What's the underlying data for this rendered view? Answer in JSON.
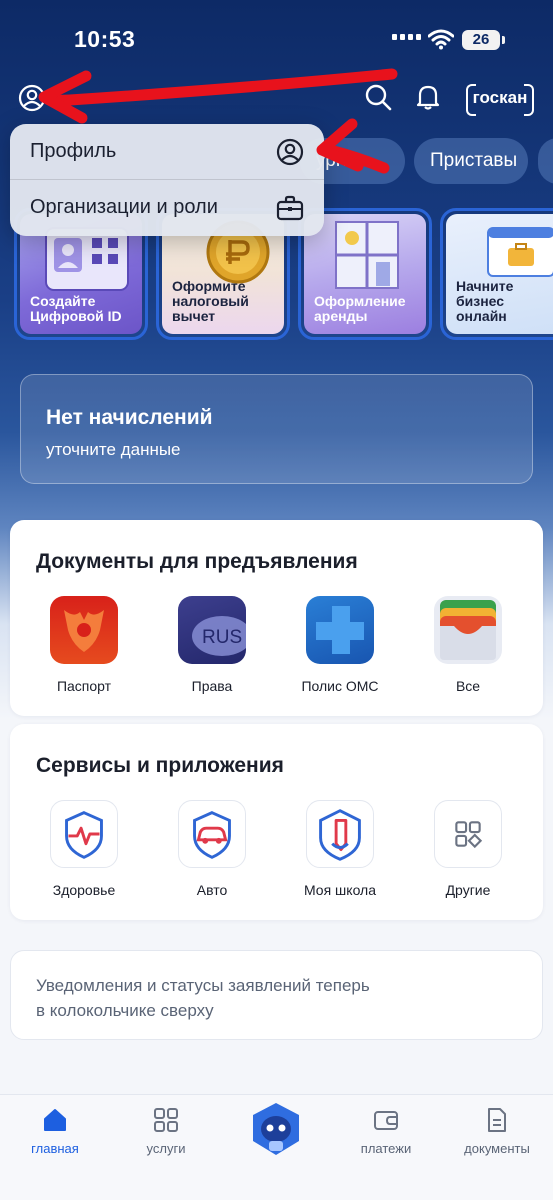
{
  "status_bar": {
    "time": "10:53",
    "battery": "26"
  },
  "header": {
    "goskan_label": "госкан"
  },
  "chips": [
    {
      "label": "ургия"
    },
    {
      "label": "Приставы"
    }
  ],
  "stories": [
    {
      "label_line1": "Создайте",
      "label_line2": "Цифровой ID",
      "label_line3": ""
    },
    {
      "label_line1": "Оформите",
      "label_line2": "налоговый",
      "label_line3": "вычет"
    },
    {
      "label_line1": "Оформление",
      "label_line2": "аренды",
      "label_line3": ""
    },
    {
      "label_line1": "Начните",
      "label_line2": "бизнес",
      "label_line3": "онлайн"
    }
  ],
  "dropdown": {
    "items": [
      {
        "label": "Профиль",
        "icon": "user-circle-icon"
      },
      {
        "label": "Организации и роли",
        "icon": "briefcase-icon"
      }
    ]
  },
  "charges": {
    "title": "Нет начислений",
    "subtitle": "уточните данные"
  },
  "documents": {
    "title": "Документы для предъявления",
    "items": [
      {
        "label": "Паспорт",
        "icon": "passport-icon"
      },
      {
        "label": "Права",
        "icon": "driver-license-icon"
      },
      {
        "label": "Полис ОМС",
        "icon": "medical-policy-icon"
      },
      {
        "label": "Все",
        "icon": "wallet-icon"
      }
    ],
    "license_text": "RUS"
  },
  "services": {
    "title": "Сервисы и приложения",
    "items": [
      {
        "label": "Здоровье",
        "icon": "health-icon"
      },
      {
        "label": "Авто",
        "icon": "car-icon"
      },
      {
        "label": "Моя школа",
        "icon": "school-icon"
      },
      {
        "label": "Другие",
        "icon": "grid-icon"
      }
    ]
  },
  "notice": {
    "text_line1": "Уведомления и статусы заявлений теперь",
    "text_line2": "в колокольчике сверху"
  },
  "bottom_nav": {
    "items": [
      {
        "label": "главная",
        "icon": "home-icon",
        "active": true
      },
      {
        "label": "услуги",
        "icon": "services-grid-icon",
        "active": false
      },
      {
        "label": "",
        "icon": "assistant-robot-icon",
        "active": false
      },
      {
        "label": "платежи",
        "icon": "wallet-payments-icon",
        "active": false
      },
      {
        "label": "документы",
        "icon": "document-icon",
        "active": false
      }
    ]
  },
  "colors": {
    "primary_blue": "#1d5fe0",
    "header_navy": "#0d2a66",
    "annotation_red": "#e8121c"
  }
}
